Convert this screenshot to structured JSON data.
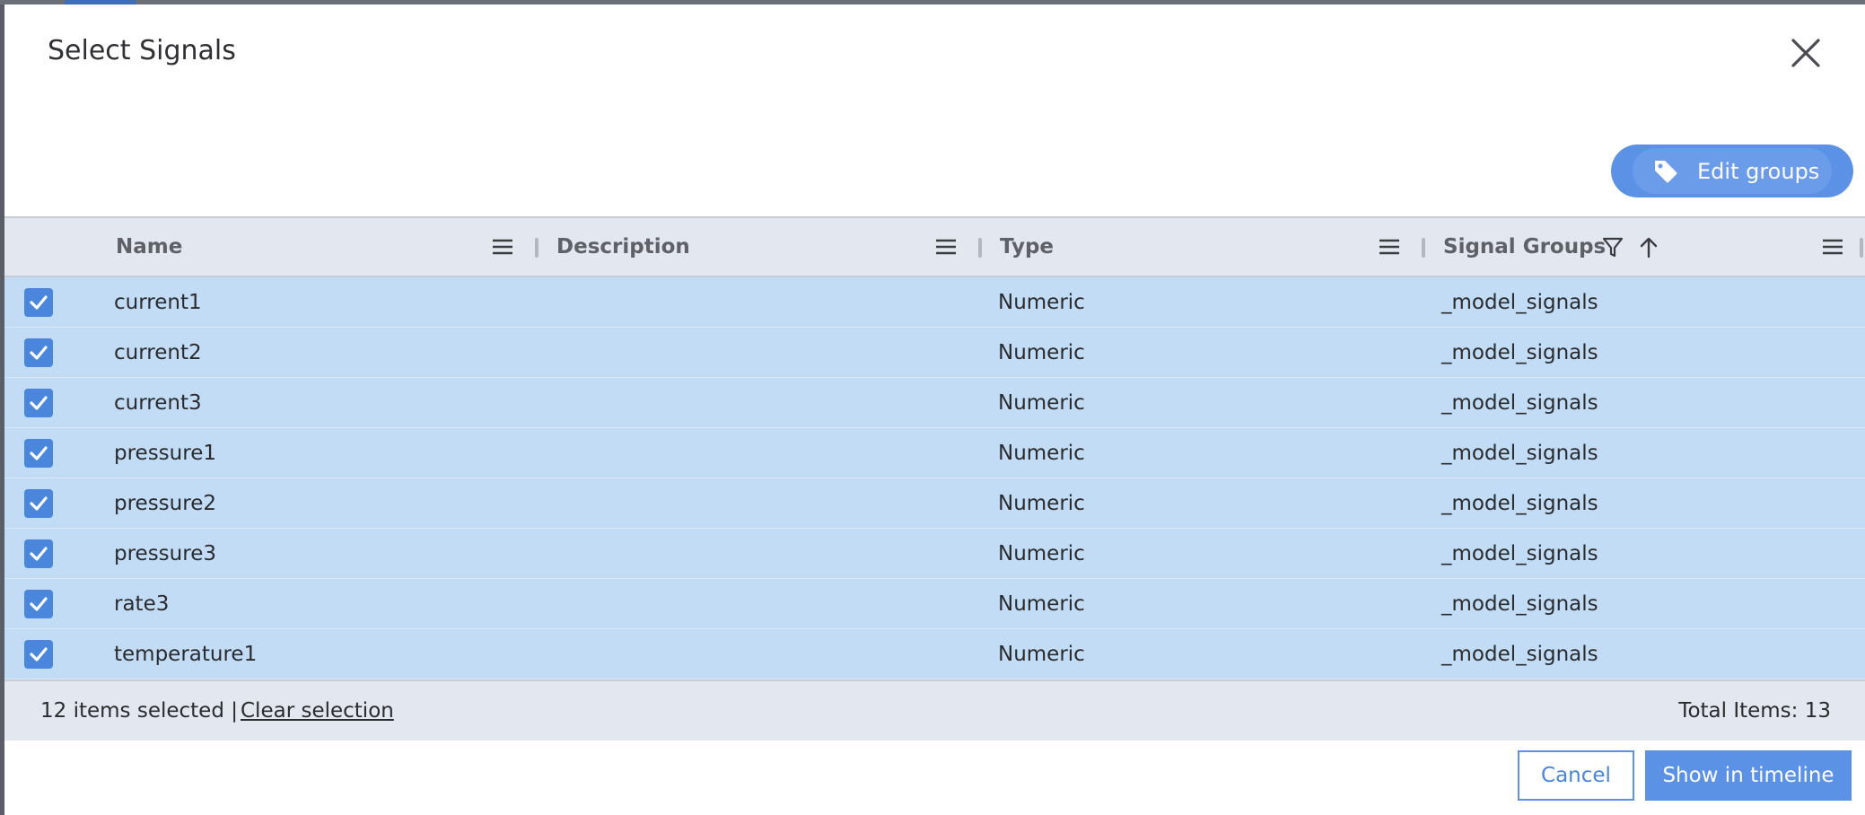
{
  "dialog": {
    "title": "Select Signals",
    "close_icon": "close-icon"
  },
  "toolbar": {
    "edit_groups_label": "Edit groups",
    "edit_groups_icon": "tag-icon"
  },
  "table": {
    "columns": [
      {
        "label": "Name"
      },
      {
        "label": "Description"
      },
      {
        "label": "Type"
      },
      {
        "label": "Signal Groups"
      }
    ],
    "rows": [
      {
        "name": "current1",
        "description": "",
        "type": "Numeric",
        "group": "_model_signals",
        "checked": true
      },
      {
        "name": "current2",
        "description": "",
        "type": "Numeric",
        "group": "_model_signals",
        "checked": true
      },
      {
        "name": "current3",
        "description": "",
        "type": "Numeric",
        "group": "_model_signals",
        "checked": true
      },
      {
        "name": "pressure1",
        "description": "",
        "type": "Numeric",
        "group": "_model_signals",
        "checked": true
      },
      {
        "name": "pressure2",
        "description": "",
        "type": "Numeric",
        "group": "_model_signals",
        "checked": true
      },
      {
        "name": "pressure3",
        "description": "",
        "type": "Numeric",
        "group": "_model_signals",
        "checked": true
      },
      {
        "name": "rate3",
        "description": "",
        "type": "Numeric",
        "group": "_model_signals",
        "checked": true
      },
      {
        "name": "temperature1",
        "description": "",
        "type": "Numeric",
        "group": "_model_signals",
        "checked": true
      }
    ]
  },
  "footer": {
    "selected_text": "12 items selected |",
    "clear_label": "Clear selection",
    "total_text": "Total Items: 13"
  },
  "actions": {
    "cancel_label": "Cancel",
    "show_label": "Show in timeline"
  },
  "colors": {
    "accent": "#5b92e5",
    "row_selected": "#c2dcf5",
    "header_bg": "#e3e7ef"
  }
}
